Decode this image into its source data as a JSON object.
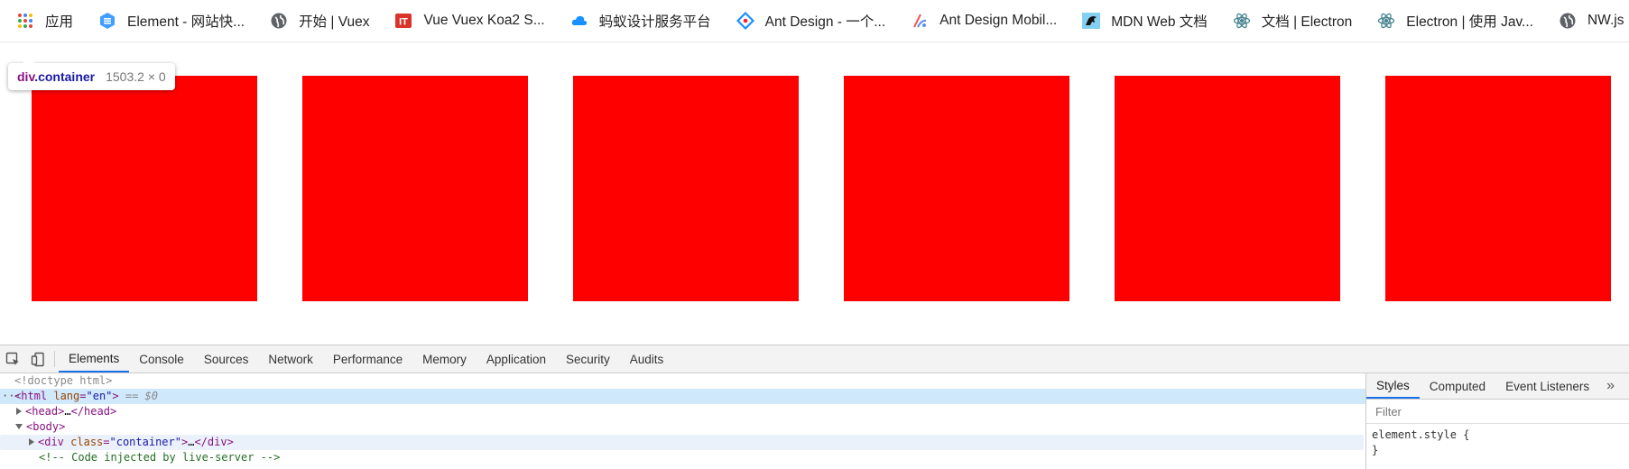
{
  "bookmarks": [
    {
      "label": "应用",
      "icon": "apps-grid-icon"
    },
    {
      "label": "Element - 网站快...",
      "icon": "element-hexagon-icon"
    },
    {
      "label": "开始 | Vuex",
      "icon": "globe-icon"
    },
    {
      "label": "Vue Vuex Koa2 S...",
      "icon": "it-logo-icon"
    },
    {
      "label": "蚂蚁设计服务平台",
      "icon": "cloud-icon"
    },
    {
      "label": "Ant Design - 一个...",
      "icon": "ant-design-icon"
    },
    {
      "label": "Ant Design Mobil...",
      "icon": "ant-mobile-icon"
    },
    {
      "label": "MDN Web 文档",
      "icon": "mdn-dino-icon"
    },
    {
      "label": "文档 | Electron",
      "icon": "electron-icon"
    },
    {
      "label": "Electron | 使用 Jav...",
      "icon": "electron-icon"
    },
    {
      "label": "NW.js",
      "icon": "globe-icon"
    }
  ],
  "page": {
    "box_color": "#ff0000",
    "box_count": 6,
    "tooltip": {
      "tag": "div",
      "class_name": ".container",
      "size": "1503.2 × 0"
    }
  },
  "devtools": {
    "tabs": [
      "Elements",
      "Console",
      "Sources",
      "Network",
      "Performance",
      "Memory",
      "Application",
      "Security",
      "Audits"
    ],
    "active_tab": "Elements",
    "dom": {
      "doctype": "<!doctype html>",
      "html_tag": "<html",
      "html_attr": "lang",
      "html_val": "\"en\"",
      "html_close": ">",
      "html_ref": "== $0",
      "head_open": "<head>",
      "head_ellipsis": "…",
      "head_close": "</head>",
      "body_open": "<body>",
      "div_open": "<div",
      "div_attr": "class",
      "div_val": "\"container\"",
      "div_close_start": ">",
      "div_ellipsis": "…",
      "div_close": "</div>",
      "comment": "<!-- Code injected by live-server -->"
    },
    "styles": {
      "tabs": [
        "Styles",
        "Computed",
        "Event Listeners"
      ],
      "active_tab": "Styles",
      "more": "»",
      "filter_placeholder": "Filter",
      "rule_open": "element.style {",
      "rule_close": "}"
    }
  }
}
